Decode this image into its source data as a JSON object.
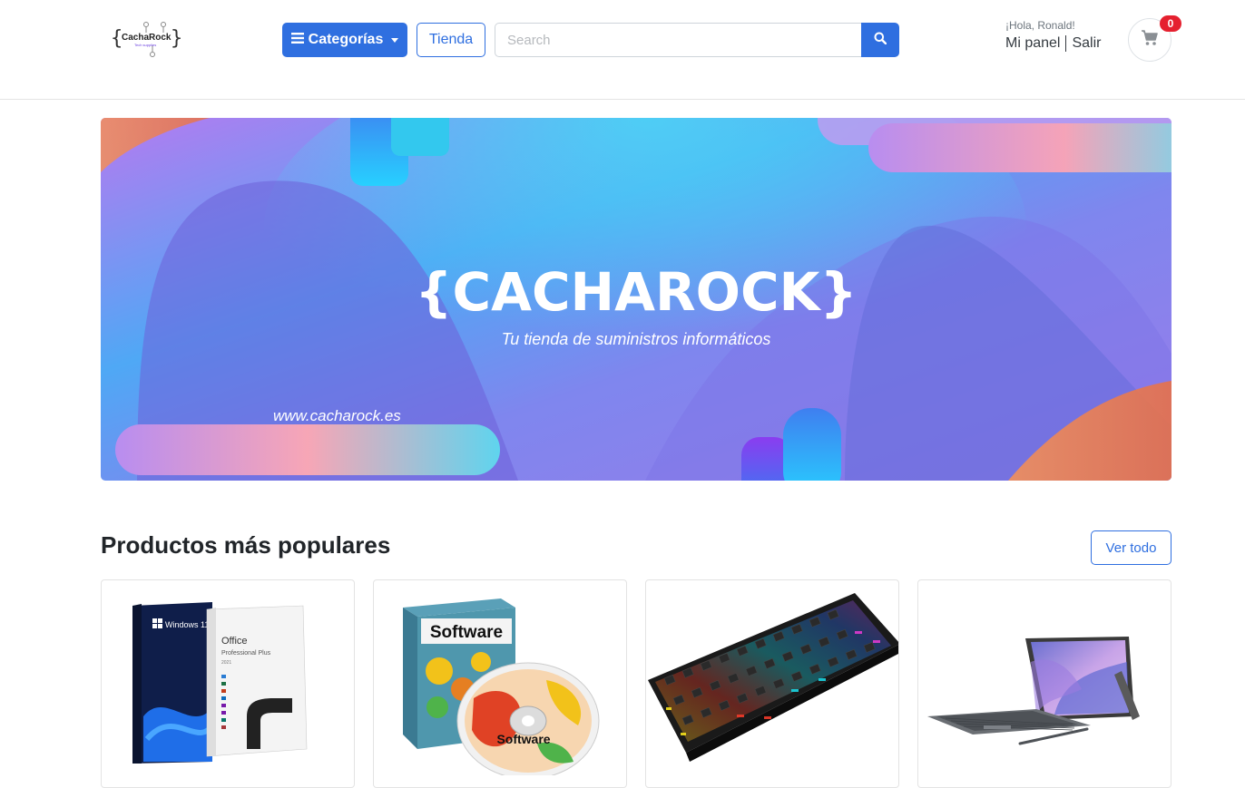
{
  "header": {
    "logo_text": "CachaRock",
    "logo_subtext": "Tech supplies",
    "categories_label": "Categorías",
    "store_label": "Tienda",
    "search": {
      "placeholder": "Search"
    },
    "greeting": "¡Hola, Ronald!",
    "panel_link": "Mi panel",
    "logout_link": "Salir",
    "cart_count": "0"
  },
  "banner": {
    "title": "{CACHAROCK}",
    "tagline": "Tu tienda de suministros informáticos",
    "url": "www.cacharock.es"
  },
  "popular": {
    "title": "Productos más populares",
    "view_all_label": "Ver todo",
    "products": [
      {
        "image": "windows-office-box",
        "box_texts": [
          "Windows 11",
          "Office",
          "Professional Plus",
          "2021"
        ]
      },
      {
        "image": "software-box",
        "box_texts": [
          "Software",
          "Software"
        ]
      },
      {
        "image": "rgb-keyboard"
      },
      {
        "image": "tablet-keyboard"
      }
    ]
  },
  "colors": {
    "primary": "#2f6fe0",
    "badge": "#e5202f",
    "banner_purple": "#8a6be8",
    "banner_blue": "#36b2f0"
  }
}
